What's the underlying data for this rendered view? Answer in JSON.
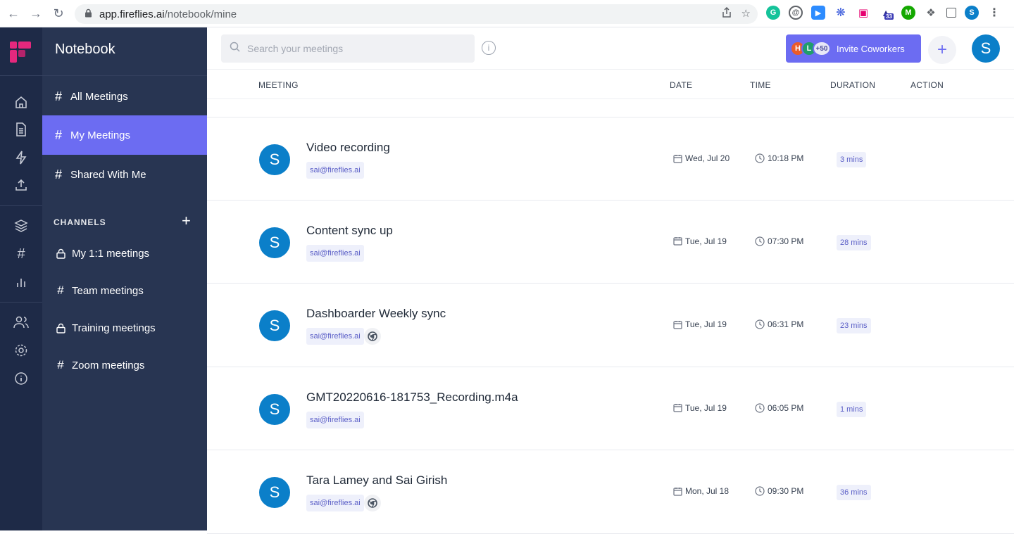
{
  "browser": {
    "url_host": "app.fireflies.ai",
    "url_path": "/notebook/mine",
    "ext_badge": "33",
    "profile_initial": "S"
  },
  "sidebar": {
    "title": "Notebook",
    "nav": [
      {
        "label": "All Meetings"
      },
      {
        "label": "My Meetings",
        "active": true
      },
      {
        "label": "Shared With Me"
      }
    ],
    "channels_heading": "CHANNELS",
    "channels": [
      {
        "label": "My 1:1 meetings",
        "icon": "lock-icon"
      },
      {
        "label": "Team meetings",
        "icon": "hash-icon"
      },
      {
        "label": "Training meetings",
        "icon": "lock-icon"
      },
      {
        "label": "Zoom meetings",
        "icon": "hash-icon"
      }
    ]
  },
  "topbar": {
    "search_placeholder": "Search your meetings",
    "invite_label": "Invite Coworkers",
    "invite_avatars": [
      "H",
      "L"
    ],
    "invite_more": "+50",
    "user_initial": "S"
  },
  "table": {
    "headers": {
      "meeting": "MEETING",
      "date": "DATE",
      "time": "TIME",
      "duration": "DURATION",
      "action": "ACTION"
    },
    "rows": [
      {
        "initial": "S",
        "title": "Video recording",
        "owner": "sai@fireflies.ai",
        "chrome": false,
        "date": "Wed, Jul 20",
        "time": "10:18 PM",
        "duration": "3 mins"
      },
      {
        "initial": "S",
        "title": "Content sync up",
        "owner": "sai@fireflies.ai",
        "chrome": false,
        "date": "Tue, Jul 19",
        "time": "07:30 PM",
        "duration": "28 mins"
      },
      {
        "initial": "S",
        "title": "Dashboarder Weekly sync",
        "owner": "sai@fireflies.ai",
        "chrome": true,
        "date": "Tue, Jul 19",
        "time": "06:31 PM",
        "duration": "23 mins"
      },
      {
        "initial": "S",
        "title": "GMT20220616-181753_Recording.m4a",
        "owner": "sai@fireflies.ai",
        "chrome": false,
        "date": "Tue, Jul 19",
        "time": "06:05 PM",
        "duration": "1 mins"
      },
      {
        "initial": "S",
        "title": "Tara Lamey and Sai Girish",
        "owner": "sai@fireflies.ai",
        "chrome": true,
        "date": "Mon, Jul 18",
        "time": "09:30 PM",
        "duration": "36 mins"
      }
    ]
  }
}
